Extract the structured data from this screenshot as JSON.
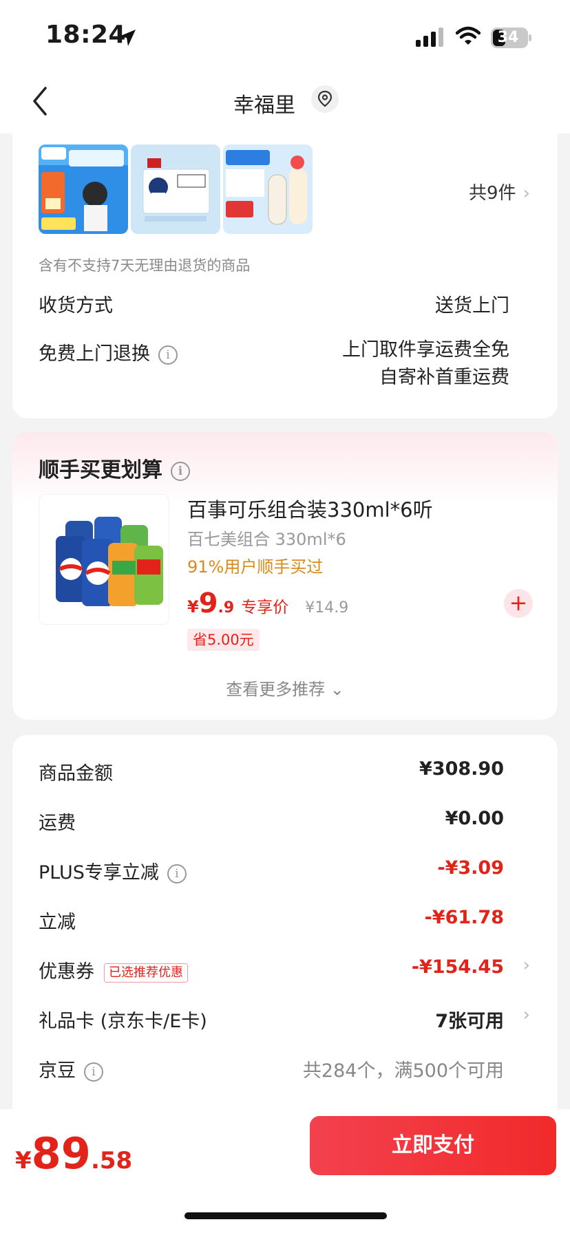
{
  "status": {
    "time": "18:24",
    "battery": "34"
  },
  "nav": {
    "title": "幸福里"
  },
  "order": {
    "item_count": "共9件",
    "notice": "含有不支持7天无理由退货的商品",
    "delivery_label": "收货方式",
    "delivery_value": "送货上门",
    "return_label": "免费上门退换",
    "return_value_1": "上门取件享运费全免",
    "return_value_2": "自寄补首重运费"
  },
  "recommend": {
    "title": "顺手买更划算",
    "product_name": "百事可乐组合装330ml*6听",
    "product_sub": "百七美组合 330ml*6",
    "product_hot": "91%用户顺手买过",
    "price_symbol": "¥",
    "price_int": "9",
    "price_dec": ".9",
    "price_tag": "专享价",
    "price_old": "¥14.9",
    "save": "省5.00元",
    "more": "查看更多推荐"
  },
  "summary": {
    "rows": [
      {
        "label": "商品金额",
        "value": "¥308.90"
      },
      {
        "label": "运费",
        "value": "¥0.00"
      },
      {
        "label": "PLUS专享立减",
        "value": "-¥3.09"
      },
      {
        "label": "立减",
        "value": "-¥61.78"
      },
      {
        "label": "优惠券",
        "value": "-¥154.45",
        "tag": "已选推荐优惠"
      },
      {
        "label": "礼品卡 (京东卡/E卡)",
        "value": "7张可用"
      },
      {
        "label": "京豆",
        "value": "共284个，满500个可用"
      }
    ]
  },
  "footer": {
    "total_symbol": "¥",
    "total_int": "89",
    "total_dec": ".58",
    "pay_label": "立即支付"
  },
  "colors": {
    "accent": "#e2231a",
    "pay_button": "#f3414f"
  },
  "icons": [
    "location-arrow-icon",
    "signal-icon",
    "wifi-icon",
    "battery-icon",
    "back-icon",
    "location-pin-icon",
    "info-icon",
    "plus-icon",
    "chevron-right-icon",
    "chevron-down-icon"
  ]
}
